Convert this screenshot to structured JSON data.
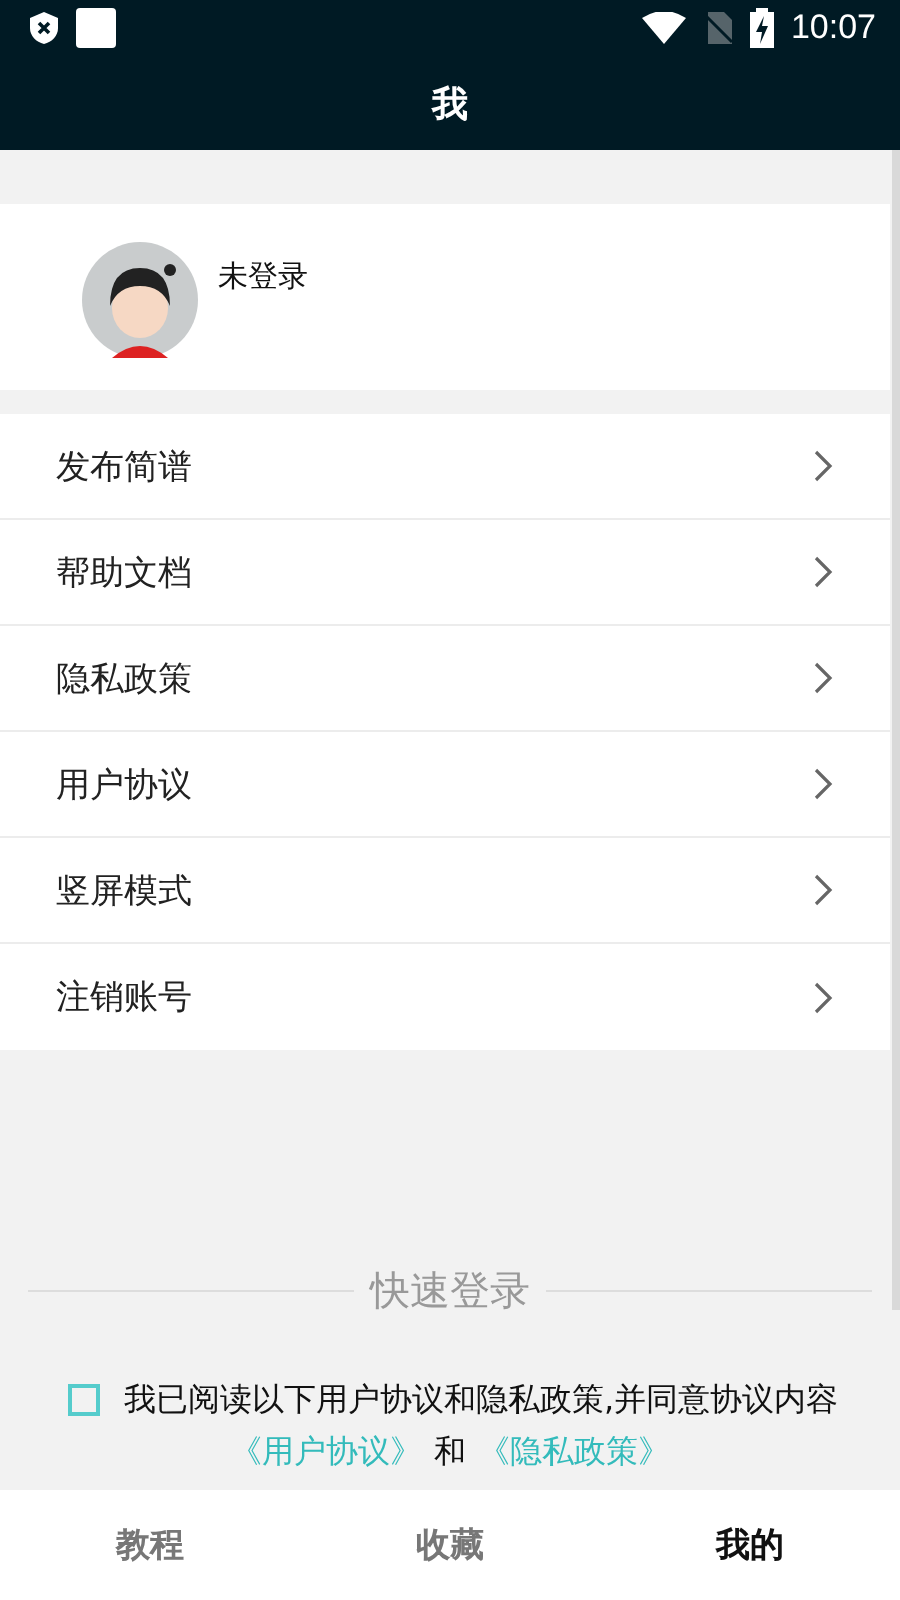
{
  "status_bar": {
    "time": "10:07"
  },
  "app_bar": {
    "title": "我"
  },
  "profile": {
    "name": "未登录"
  },
  "menu_items": [
    {
      "label": "发布简谱"
    },
    {
      "label": "帮助文档"
    },
    {
      "label": "隐私政策"
    },
    {
      "label": "用户协议"
    },
    {
      "label": "竖屏模式"
    },
    {
      "label": "注销账号"
    }
  ],
  "quick_login": {
    "heading": "快速登录",
    "agree_checked": false,
    "agree_text": "我已阅读以下用户协议和隐私政策,并同意协议内容",
    "links": [
      "《用户协议》",
      "和",
      "《隐私政策》"
    ]
  },
  "bottom_nav": [
    {
      "label": "教程",
      "selected": false
    },
    {
      "label": "收藏",
      "selected": false
    },
    {
      "label": "我的",
      "selected": true
    }
  ]
}
